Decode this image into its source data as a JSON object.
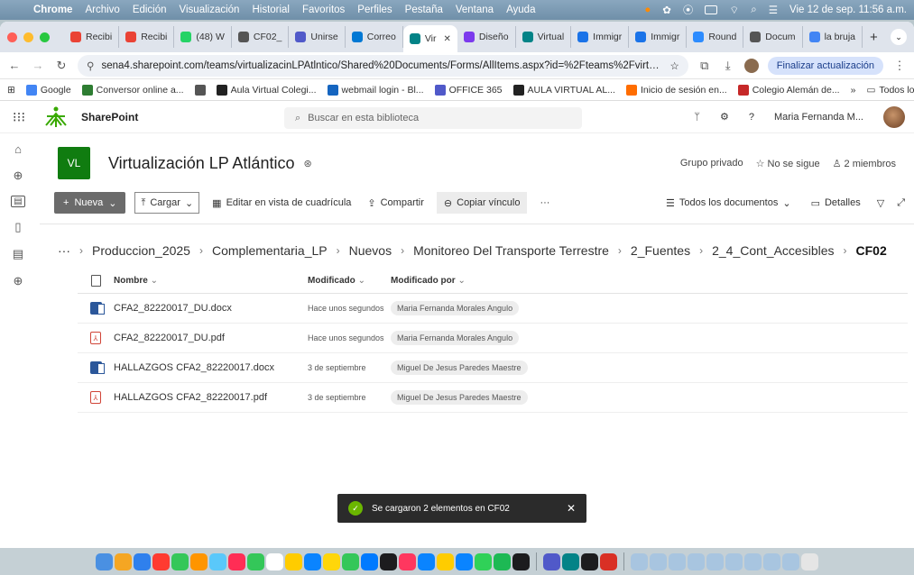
{
  "macbar": {
    "app": "Chrome",
    "menus": [
      "Archivo",
      "Edición",
      "Visualización",
      "Historial",
      "Favoritos",
      "Perfiles",
      "Pestaña",
      "Ventana",
      "Ayuda"
    ],
    "datetime": "Vie 12 de sep.  11:56 a.m."
  },
  "tabs": [
    {
      "label": "Recibi",
      "color": "#ea4335"
    },
    {
      "label": "Recibi",
      "color": "#ea4335"
    },
    {
      "label": "(48) W",
      "color": "#25d366"
    },
    {
      "label": "CF02_",
      "color": "#555555"
    },
    {
      "label": "Unirse",
      "color": "#5059c9"
    },
    {
      "label": "Correo",
      "color": "#0078d4"
    },
    {
      "label": "Vir",
      "color": "#038387",
      "active": true
    },
    {
      "label": "Diseño",
      "color": "#7c3aed"
    },
    {
      "label": "Virtual",
      "color": "#038387"
    },
    {
      "label": "Immigr",
      "color": "#1a73e8"
    },
    {
      "label": "Immigr",
      "color": "#1a73e8"
    },
    {
      "label": "Round",
      "color": "#2d8cff"
    },
    {
      "label": "Docum",
      "color": "#555555"
    },
    {
      "label": "la bruja",
      "color": "#4285f4"
    }
  ],
  "address": {
    "url": "sena4.sharepoint.com/teams/virtualizacinLPAtlntico/Shared%20Documents/Forms/AllItems.aspx?id=%2Fteams%2FvirtualizacinLPAtlnti...",
    "update_label": "Finalizar actualización"
  },
  "bookmarks": [
    {
      "label": "Google",
      "color": "#4285f4"
    },
    {
      "label": "Conversor online a...",
      "color": "#2e7d32"
    },
    {
      "label": "",
      "color": "#555555"
    },
    {
      "label": "Aula Virtual Colegi...",
      "color": "#222222"
    },
    {
      "label": "webmail login - Bl...",
      "color": "#1565c0"
    },
    {
      "label": "OFFICE 365",
      "color": "#5059c9"
    },
    {
      "label": "AULA VIRTUAL AL...",
      "color": "#222222"
    },
    {
      "label": "Inicio de sesión en...",
      "color": "#ff6d00"
    },
    {
      "label": "Colegio Alemán de...",
      "color": "#c62828"
    }
  ],
  "bookmarks_all": "Todos los favoritos",
  "sharepoint": {
    "app_name": "SharePoint",
    "search_placeholder": "Buscar en esta biblioteca",
    "user_name": "Maria Fernanda M...",
    "site_initials": "VL",
    "site_name": "Virtualización LP Atlántico",
    "privacy": "Grupo privado",
    "follow": "No se sigue",
    "members": "2 miembros"
  },
  "commands": {
    "new": "Nueva",
    "upload": "Cargar",
    "grid_edit": "Editar en vista de cuadrícula",
    "share": "Compartir",
    "copy_link": "Copiar vínculo",
    "more": "···",
    "all_docs": "Todos los documentos",
    "details": "Detalles"
  },
  "breadcrumb": [
    "···",
    "Produccion_2025",
    "Complementaria_LP",
    "Nuevos",
    "Monitoreo Del Transporte Terrestre",
    "2_Fuentes",
    "2_4_Cont_Accesibles",
    "CF02"
  ],
  "table": {
    "headers": {
      "name": "Nombre",
      "modified": "Modificado",
      "modified_by": "Modificado por"
    },
    "rows": [
      {
        "type": "docx",
        "name": "CFA2_82220017_DU.docx",
        "modified": "Hace unos segundos",
        "by": "Maria Fernanda Morales Angulo"
      },
      {
        "type": "pdf",
        "name": "CFA2_82220017_DU.pdf",
        "modified": "Hace unos segundos",
        "by": "Maria Fernanda Morales Angulo"
      },
      {
        "type": "docx",
        "name": "HALLAZGOS CFA2_82220017.docx",
        "modified": "3 de septiembre",
        "by": "Miguel De Jesus Paredes Maestre"
      },
      {
        "type": "pdf",
        "name": "HALLAZGOS CFA2_82220017.pdf",
        "modified": "3 de septiembre",
        "by": "Miguel De Jesus Paredes Maestre"
      }
    ]
  },
  "toast": "Se cargaron 2 elementos en CF02",
  "dock_colors": [
    "#4a90e2",
    "#f5a623",
    "#2f80ed",
    "#ff3b30",
    "#34c759",
    "#ff9500",
    "#5ac8fa",
    "#ff2d55",
    "#34c759",
    "#ffffff",
    "#ffcc00",
    "#0a84ff",
    "#ffd60a",
    "#34c759",
    "#007aff",
    "#1c1c1e",
    "#ff375f",
    "#0a84ff",
    "#ffcc00",
    "#0a84ff",
    "#30d158",
    "#1db954",
    "#1c1c1e",
    "#5059c9",
    "#038387",
    "#1c1c1e",
    "#d93025",
    "#a8c5e0",
    "#a8c5e0",
    "#a8c5e0",
    "#a8c5e0",
    "#a8c5e0",
    "#a8c5e0",
    "#a8c5e0",
    "#a8c5e0",
    "#a8c5e0",
    "#e5e5e5"
  ]
}
